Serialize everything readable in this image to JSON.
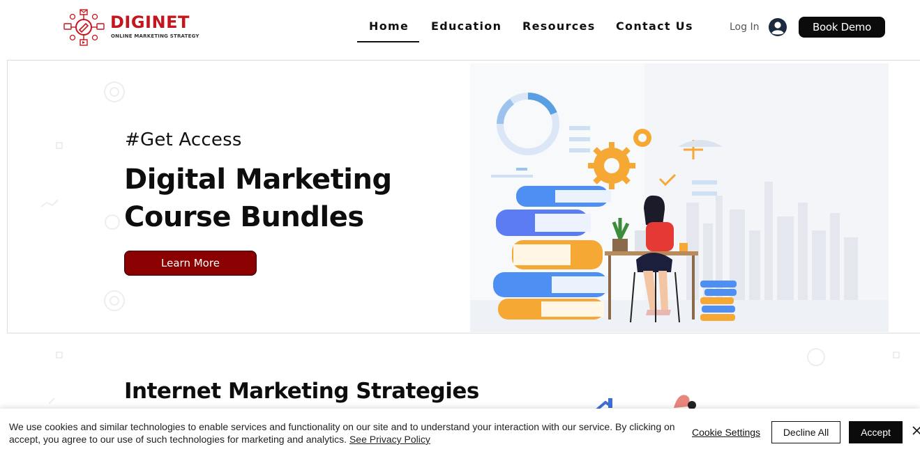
{
  "header": {
    "logo_name": "DIGINET",
    "logo_tagline": "ONLINE MARKETING STRATEGY",
    "nav": [
      {
        "label": "Home",
        "active": true
      },
      {
        "label": "Education",
        "active": false
      },
      {
        "label": "Resources",
        "active": false
      },
      {
        "label": "Contact Us",
        "active": false
      }
    ],
    "login_label": "Log In",
    "user_icon": "user-circle-icon",
    "cta_label": "Book Demo"
  },
  "hero": {
    "eyebrow": "#Get Access",
    "title": "Digital Marketing Course Bundles",
    "button_label": "Learn More",
    "illustration": "woman-working-laptop-books-illustration"
  },
  "section": {
    "title": "Internet Marketing Strategies"
  },
  "cookie_bar": {
    "text": "We use cookies and similar technologies to enable services and functionality on our site and to understand your interaction with our service. By clicking on accept, you agree to our use of such technologies for marketing and analytics.",
    "policy_link": "See Privacy Policy",
    "settings_label": "Cookie Settings",
    "decline_label": "Decline All",
    "accept_label": "Accept",
    "close_icon": "close-icon"
  },
  "colors": {
    "brand_red": "#c4161c",
    "button_dark_red": "#8b0000",
    "black": "#0b0b0b"
  }
}
